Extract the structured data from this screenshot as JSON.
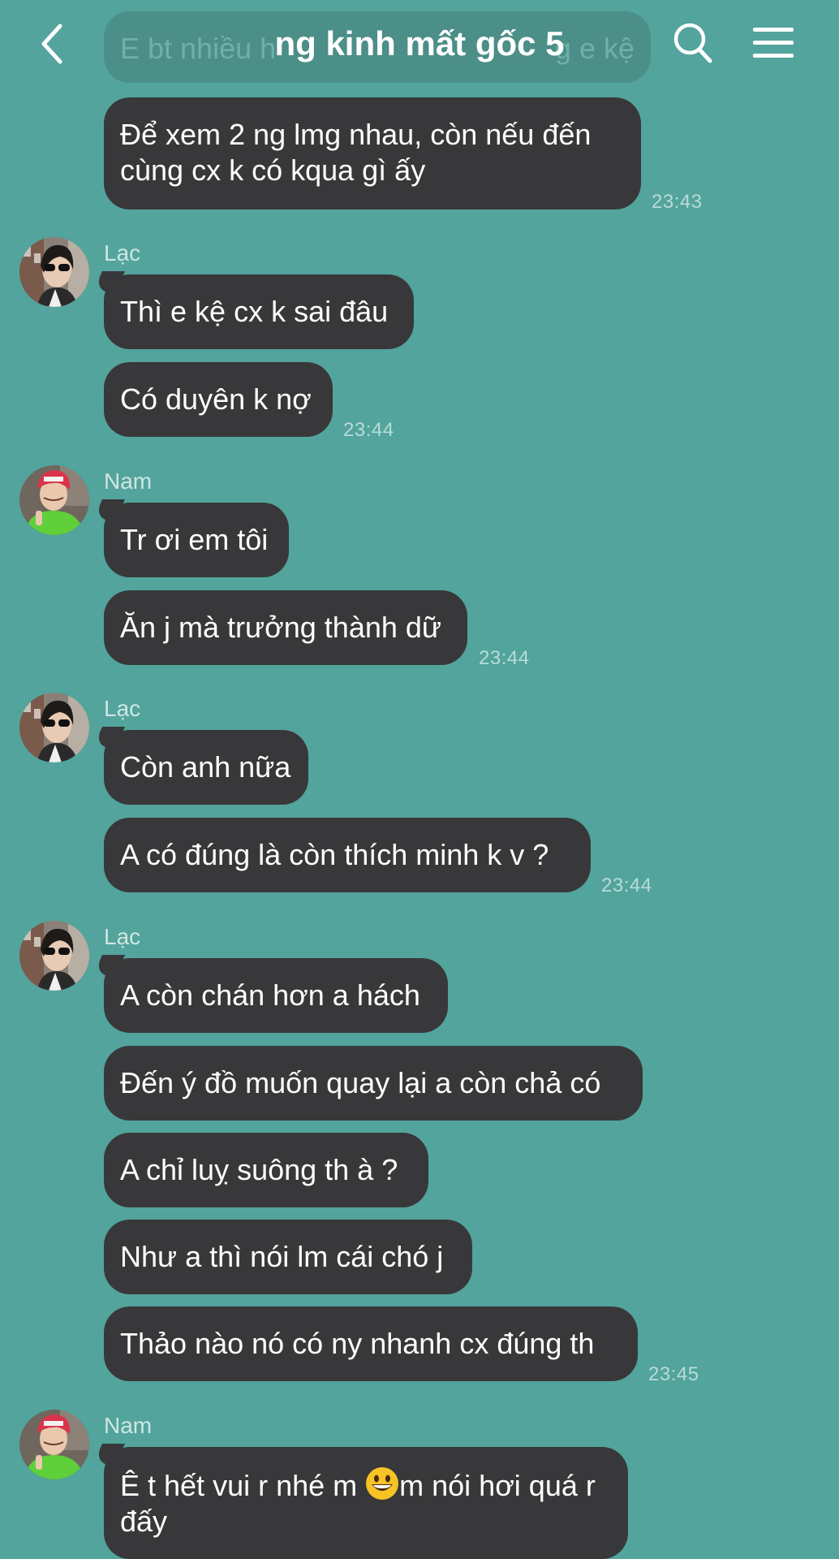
{
  "header": {
    "title": "ng kinh mất gốc 5"
  },
  "colors": {
    "background": "#52a49c",
    "bubble": "#38383a",
    "text": "#ffffff"
  },
  "icons": {
    "back": "chevron-left-icon",
    "search": "search-icon",
    "menu": "hamburger-menu-icon"
  },
  "messages": {
    "m0": "E bt nhiều h",
    "m0_tail": "g e kệ",
    "m1": "Để xem 2 ng lmg nhau, còn nếu đến cùng cx k có kqua gì ấy",
    "t1": "23:43",
    "s2": "Lạc",
    "m2": "Thì e kệ cx k sai đâu",
    "m3": "Có duyên k nợ",
    "t3": "23:44",
    "s4": "Nam",
    "m4": "Tr ơi em tôi",
    "m5": "Ăn j mà trưởng thành dữ",
    "t5": "23:44",
    "s6": "Lạc",
    "m6": "Còn anh nữa",
    "m7": "A có đúng là còn thích minh k v ?",
    "t7": "23:44",
    "s8": "Lạc",
    "m8": "A còn chán hơn a hách",
    "m9": "Đến ý đồ muốn quay lại a còn chả có",
    "m10": "A chỉ luỵ suông th à ?",
    "m11": "Như a thì nói lm cái chó j",
    "m12": "Thảo nào nó có ny nhanh cx đúng th",
    "t12": "23:45",
    "s13": "Nam",
    "m13a": "Ê t hết vui r nhé m ",
    "m13b": "m nói hơi quá r đấy"
  }
}
